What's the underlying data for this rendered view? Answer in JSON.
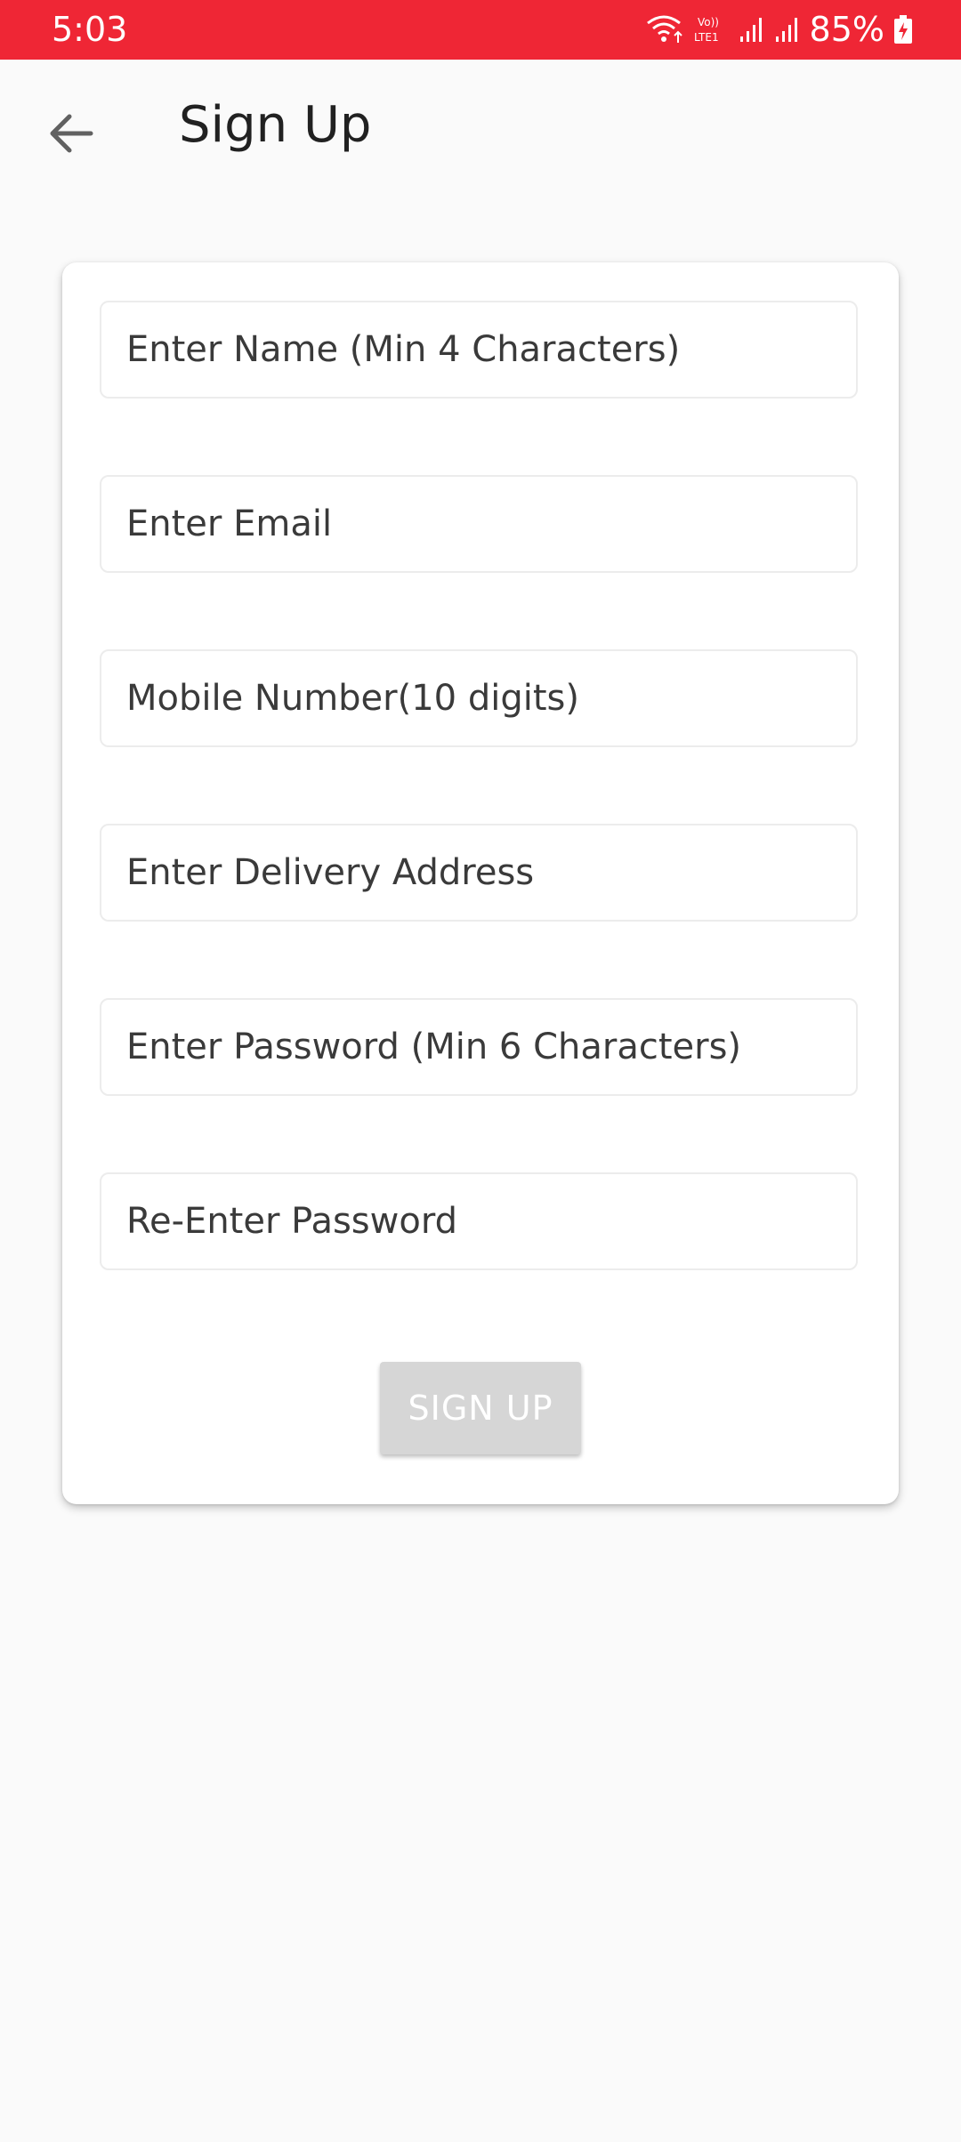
{
  "status_bar": {
    "time": "5:03",
    "battery": "85%",
    "icons": [
      "wifi-icon",
      "volte-icon",
      "signal-icon",
      "signal-icon",
      "battery-charging-icon"
    ],
    "background_color": "#ef2635"
  },
  "app_bar": {
    "back_icon": "arrow-back-icon",
    "title": "Sign Up"
  },
  "form": {
    "fields": {
      "name": {
        "value": "",
        "placeholder": "Enter Name (Min 4 Characters)"
      },
      "email": {
        "value": "",
        "placeholder": "Enter Email"
      },
      "mobile": {
        "value": "",
        "placeholder": "Mobile Number(10 digits)"
      },
      "address": {
        "value": "",
        "placeholder": "Enter Delivery Address"
      },
      "password": {
        "value": "",
        "placeholder": "Enter Password (Min 6 Characters)"
      },
      "confirm_password": {
        "value": "",
        "placeholder": "Re-Enter Password"
      }
    },
    "submit_label": "SIGN UP",
    "submit_color": "#d6d6d6"
  }
}
